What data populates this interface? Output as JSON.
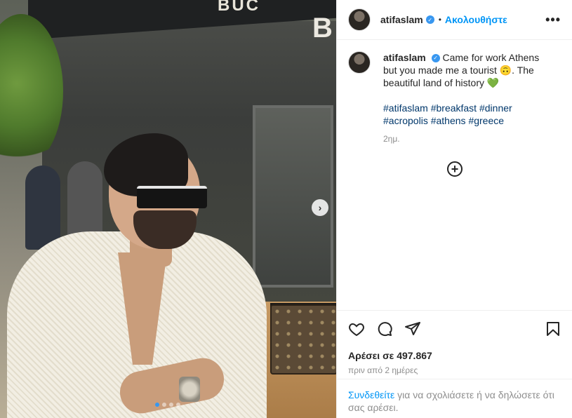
{
  "photo": {
    "awning_text": "BUC",
    "building_sign": "B",
    "carousel_dots": 4,
    "active_dot": 1
  },
  "header": {
    "username": "atifaslam",
    "separator": "•",
    "follow_label": "Ακολουθήστε",
    "more_icon": "ellipsis-icon"
  },
  "caption": {
    "username": "atifaslam",
    "text": "Came for work Athens but you made me a tourist 🙃. The beautiful land of history 💚",
    "hashtags": [
      "#atifaslam",
      "#breakfast",
      "#dinner",
      "#acropolis",
      "#athens",
      "#greece"
    ],
    "time": "2ημ."
  },
  "actions": {
    "icons": [
      "heart-icon",
      "comment-icon",
      "share-icon",
      "bookmark-icon"
    ],
    "likes": "Αρέσει σε 497.867",
    "date": "πριν από 2 ημέρες"
  },
  "login": {
    "link": "Συνδεθείτε",
    "text": " για να σχολιάσετε ή να δηλώσετε ότι σας αρέσει."
  },
  "colors": {
    "accent": "#0095f6",
    "verified": "#3897f0",
    "hashtag": "#00376b",
    "muted": "#8e8e8e"
  }
}
